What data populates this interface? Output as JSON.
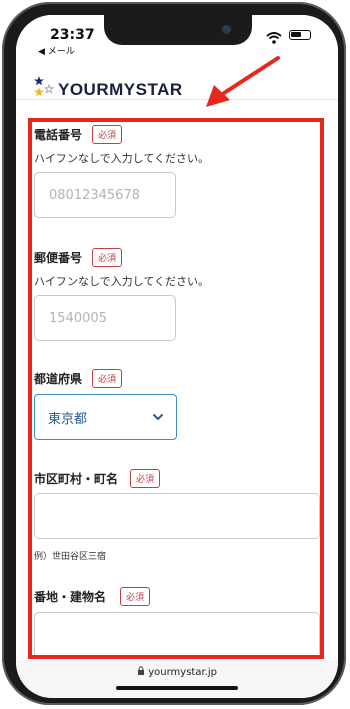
{
  "status_bar": {
    "time": "23:37",
    "back_label": "◀ メール"
  },
  "header": {
    "logo_text": "YOURMYSTAR"
  },
  "form": {
    "phone": {
      "label": "電話番号",
      "required": "必須",
      "hint": "ハイフンなしで入力してください。",
      "placeholder": "08012345678"
    },
    "postal": {
      "label": "郵便番号",
      "required": "必須",
      "hint": "ハイフンなしで入力してください。",
      "placeholder": "1540005"
    },
    "prefecture": {
      "label": "都道府県",
      "required": "必須",
      "selected": "東京都"
    },
    "city": {
      "label": "市区町村・町名",
      "required": "必須",
      "value": "",
      "example": "例）世田谷区三宿"
    },
    "address": {
      "label": "番地・建物名",
      "required": "必須",
      "value": ""
    }
  },
  "browser": {
    "url": "yourmystar.jp"
  },
  "colors": {
    "annotation": "#e8271e",
    "required_badge": "#c0404a",
    "select_border": "#3a8ec0"
  }
}
